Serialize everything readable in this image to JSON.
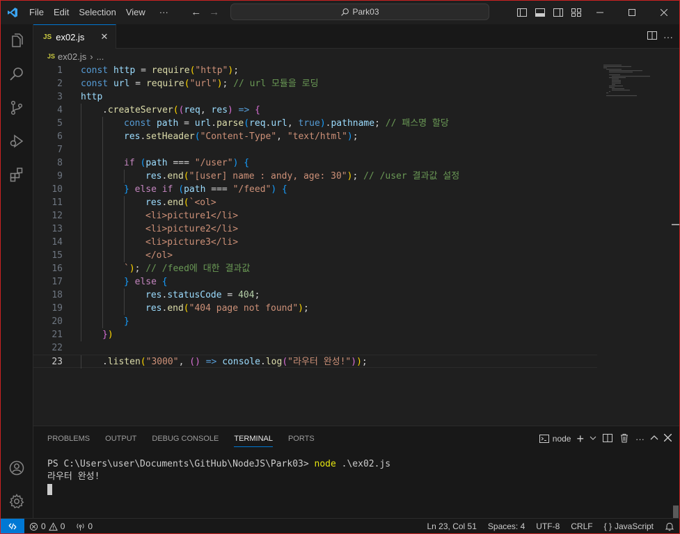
{
  "titlebar": {
    "menus": [
      "File",
      "Edit",
      "Selection",
      "View",
      "···"
    ],
    "search_text": "Park03"
  },
  "tab": {
    "label": "ex02.js",
    "badge": "JS",
    "close": "✕"
  },
  "breadcrumb": {
    "badge": "JS",
    "file": "ex02.js",
    "sep": "›",
    "more": "..."
  },
  "editor": {
    "lines": [
      {
        "n": "1",
        "indent": 0,
        "tokens": [
          [
            "const ",
            "kw"
          ],
          [
            "http",
            "var"
          ],
          [
            " = ",
            "op"
          ],
          [
            "require",
            "fn"
          ],
          [
            "(",
            "p1"
          ],
          [
            "\"http\"",
            "str"
          ],
          [
            ")",
            "p1"
          ],
          [
            ";",
            "op"
          ]
        ]
      },
      {
        "n": "2",
        "indent": 0,
        "tokens": [
          [
            "const ",
            "kw"
          ],
          [
            "url",
            "var"
          ],
          [
            " = ",
            "op"
          ],
          [
            "require",
            "fn"
          ],
          [
            "(",
            "p1"
          ],
          [
            "\"url\"",
            "str"
          ],
          [
            ")",
            "p1"
          ],
          [
            "; ",
            "op"
          ],
          [
            "// url 모듈을 로딩",
            "cmt"
          ]
        ]
      },
      {
        "n": "3",
        "indent": 0,
        "tokens": [
          [
            "http",
            "var"
          ]
        ]
      },
      {
        "n": "4",
        "indent": 1,
        "tokens": [
          [
            ".",
            "op"
          ],
          [
            "createServer",
            "fn"
          ],
          [
            "(",
            "p1"
          ],
          [
            "(",
            "p2"
          ],
          [
            "req",
            "var"
          ],
          [
            ", ",
            "op"
          ],
          [
            "res",
            "var"
          ],
          [
            ")",
            "p2"
          ],
          [
            " => ",
            "kw"
          ],
          [
            "{",
            "p2"
          ]
        ]
      },
      {
        "n": "5",
        "indent": 2,
        "tokens": [
          [
            "const ",
            "kw"
          ],
          [
            "path",
            "var"
          ],
          [
            " = ",
            "op"
          ],
          [
            "url",
            "var"
          ],
          [
            ".",
            "op"
          ],
          [
            "parse",
            "fn"
          ],
          [
            "(",
            "p3"
          ],
          [
            "req",
            "var"
          ],
          [
            ".",
            "op"
          ],
          [
            "url",
            "var"
          ],
          [
            ", ",
            "op"
          ],
          [
            "true",
            "kw"
          ],
          [
            ")",
            "p3"
          ],
          [
            ".",
            "op"
          ],
          [
            "pathname",
            "var"
          ],
          [
            "; ",
            "op"
          ],
          [
            "// 패스명 할당",
            "cmt"
          ]
        ]
      },
      {
        "n": "6",
        "indent": 2,
        "tokens": [
          [
            "res",
            "var"
          ],
          [
            ".",
            "op"
          ],
          [
            "setHeader",
            "fn"
          ],
          [
            "(",
            "p3"
          ],
          [
            "\"Content-Type\"",
            "str"
          ],
          [
            ", ",
            "op"
          ],
          [
            "\"text/html\"",
            "str"
          ],
          [
            ")",
            "p3"
          ],
          [
            ";",
            "op"
          ]
        ]
      },
      {
        "n": "7",
        "indent": 2,
        "tokens": []
      },
      {
        "n": "8",
        "indent": 2,
        "tokens": [
          [
            "if ",
            "ctl"
          ],
          [
            "(",
            "p3"
          ],
          [
            "path",
            "var"
          ],
          [
            " === ",
            "op"
          ],
          [
            "\"/user\"",
            "str"
          ],
          [
            ") ",
            "p3"
          ],
          [
            "{",
            "p3"
          ]
        ]
      },
      {
        "n": "9",
        "indent": 3,
        "tokens": [
          [
            "res",
            "var"
          ],
          [
            ".",
            "op"
          ],
          [
            "end",
            "fn"
          ],
          [
            "(",
            "p1"
          ],
          [
            "\"[user] name : andy, age: 30\"",
            "str"
          ],
          [
            ")",
            "p1"
          ],
          [
            "; ",
            "op"
          ],
          [
            "// /user 결과값 설정",
            "cmt"
          ]
        ]
      },
      {
        "n": "10",
        "indent": 2,
        "tokens": [
          [
            "} ",
            "p3"
          ],
          [
            "else ",
            "ctl"
          ],
          [
            "if ",
            "ctl"
          ],
          [
            "(",
            "p3"
          ],
          [
            "path",
            "var"
          ],
          [
            " === ",
            "op"
          ],
          [
            "\"/feed\"",
            "str"
          ],
          [
            ") ",
            "p3"
          ],
          [
            "{",
            "p3"
          ]
        ]
      },
      {
        "n": "11",
        "indent": 3,
        "tokens": [
          [
            "res",
            "var"
          ],
          [
            ".",
            "op"
          ],
          [
            "end",
            "fn"
          ],
          [
            "(",
            "p1"
          ],
          [
            "`<ol>",
            "str"
          ]
        ]
      },
      {
        "n": "12",
        "indent": 3,
        "tokens": [
          [
            "<li>picture1</li>",
            "str"
          ]
        ]
      },
      {
        "n": "13",
        "indent": 3,
        "tokens": [
          [
            "<li>picture2</li>",
            "str"
          ]
        ]
      },
      {
        "n": "14",
        "indent": 3,
        "tokens": [
          [
            "<li>picture3</li>",
            "str"
          ]
        ]
      },
      {
        "n": "15",
        "indent": 3,
        "tokens": [
          [
            "</ol>",
            "str"
          ]
        ]
      },
      {
        "n": "16",
        "indent": 2,
        "tokens": [
          [
            "`",
            "str"
          ],
          [
            ")",
            "p1"
          ],
          [
            "; ",
            "op"
          ],
          [
            "// /feed에 대한 결과값",
            "cmt"
          ]
        ]
      },
      {
        "n": "17",
        "indent": 2,
        "tokens": [
          [
            "} ",
            "p3"
          ],
          [
            "else ",
            "ctl"
          ],
          [
            "{",
            "p3"
          ]
        ]
      },
      {
        "n": "18",
        "indent": 3,
        "tokens": [
          [
            "res",
            "var"
          ],
          [
            ".",
            "op"
          ],
          [
            "statusCode",
            "var"
          ],
          [
            " = ",
            "op"
          ],
          [
            "404",
            "num"
          ],
          [
            ";",
            "op"
          ]
        ]
      },
      {
        "n": "19",
        "indent": 3,
        "tokens": [
          [
            "res",
            "var"
          ],
          [
            ".",
            "op"
          ],
          [
            "end",
            "fn"
          ],
          [
            "(",
            "p1"
          ],
          [
            "\"404 page not found\"",
            "str"
          ],
          [
            ")",
            "p1"
          ],
          [
            ";",
            "op"
          ]
        ]
      },
      {
        "n": "20",
        "indent": 2,
        "tokens": [
          [
            "}",
            "p3"
          ]
        ]
      },
      {
        "n": "21",
        "indent": 1,
        "tokens": [
          [
            "}",
            "p2"
          ],
          [
            ")",
            "p1"
          ]
        ]
      },
      {
        "n": "22",
        "indent": 0,
        "tokens": []
      },
      {
        "n": "23",
        "indent": 1,
        "tokens": [
          [
            ".",
            "op"
          ],
          [
            "listen",
            "fn"
          ],
          [
            "(",
            "p1"
          ],
          [
            "\"3000\"",
            "str"
          ],
          [
            ", ",
            "op"
          ],
          [
            "(",
            "p2"
          ],
          [
            ")",
            "p2"
          ],
          [
            " => ",
            "kw"
          ],
          [
            "console",
            "var"
          ],
          [
            ".",
            "op"
          ],
          [
            "log",
            "fn"
          ],
          [
            "(",
            "p2"
          ],
          [
            "\"라우터 완성!\"",
            "str"
          ],
          [
            ")",
            "p2"
          ],
          [
            ")",
            "p1"
          ],
          [
            ";",
            "op"
          ]
        ]
      }
    ],
    "current_line": "23"
  },
  "panel": {
    "tabs": [
      "PROBLEMS",
      "OUTPUT",
      "DEBUG CONSOLE",
      "TERMINAL",
      "PORTS"
    ],
    "active_tab": "TERMINAL",
    "terminal_name": "node",
    "prompt": "PS C:\\Users\\user\\Documents\\GitHub\\NodeJS\\Park03> ",
    "command": "node",
    "command_args": " .\\ex02.js",
    "output": "라우터 완성!"
  },
  "statusbar": {
    "errors": "0",
    "warnings": "0",
    "ports": "0",
    "position": "Ln 23, Col 51",
    "spaces": "Spaces: 4",
    "encoding": "UTF-8",
    "eol": "CRLF",
    "language": "JavaScript",
    "language_braces": "{ }"
  },
  "colors": {
    "accent": "#0078d4",
    "background": "#1f1f1f"
  }
}
